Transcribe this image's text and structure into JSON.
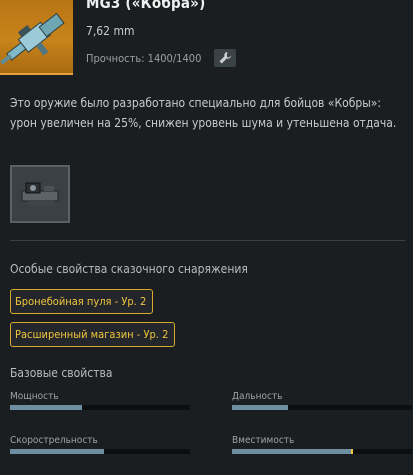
{
  "weapon": {
    "title": "MG3 («Кобра»)",
    "caliber": "7,62 mm",
    "durability": "Прочность: 1400/1400",
    "description": "Это оружие было разработано специально для бойцов «Кобры»: урон увеличен на 25%, снижен уровень шума и утеньшена отдача."
  },
  "icons": {
    "weapon": "machine-gun-icon",
    "repair": "wrench-icon",
    "attachment": "scope-attachment-icon"
  },
  "legendary": {
    "title": "Особые свойства сказочного снаряжения",
    "traits": [
      "Бронебойная пуля - Ур. 2",
      "Расширенный магазин - Ур. 2"
    ]
  },
  "base": {
    "title": "Базовые свойства",
    "stats": [
      {
        "label": "Мощность",
        "value": 0.4
      },
      {
        "label": "Дальность",
        "value": 0.31
      },
      {
        "label": "Скорострельность",
        "value": 0.52
      },
      {
        "label": "Вместимость",
        "value": 0.66,
        "bonus": true
      }
    ]
  },
  "colors": {
    "accent": "#f2c53d",
    "thumb_bg": "#c7841b",
    "bar_fill": "#6e8ea1",
    "background": "#1a1e21"
  }
}
